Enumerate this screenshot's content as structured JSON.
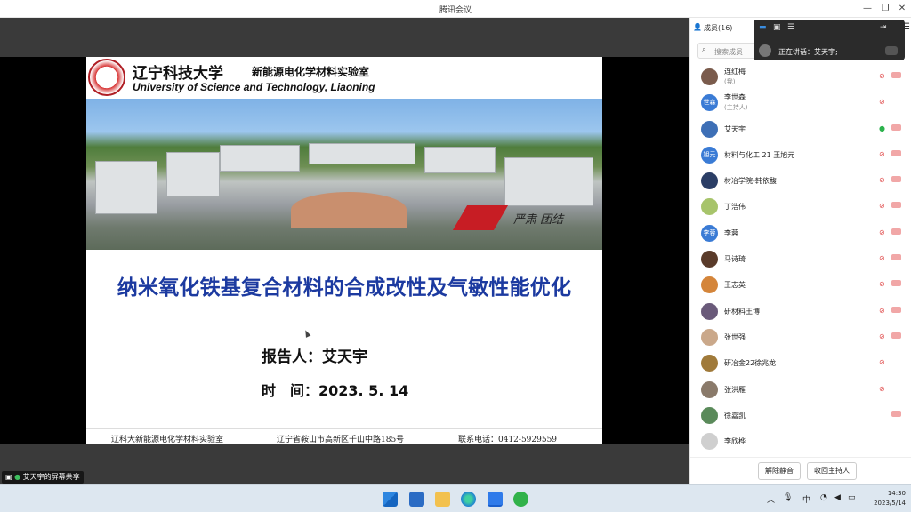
{
  "window": {
    "title": "腾讯会议"
  },
  "share_label": "艾天宇的屏幕共享",
  "slide": {
    "university_cn": "辽宁科技大学",
    "lab_cn": "新能源电化学材料实验室",
    "university_en": "University of Science and Technology, Liaoning",
    "signature": "严肃 团结",
    "title": "纳米氧化铁基复合材料的合成改性及气敏性能优化",
    "presenter": "报告人：艾天宇",
    "date": "时　间：2023. 5. 14",
    "footer": {
      "lab": "辽科大新能源电化学材料实验室",
      "address": "辽宁省鞍山市高新区千山中路185号",
      "phone": "联系电话：0412-5929559"
    }
  },
  "panel": {
    "members_title": "成员(16)",
    "search_placeholder": "搜索成员",
    "speaking": "正在讲话：艾天宇;",
    "members": [
      {
        "name": "连红梅",
        "sub": "(我)",
        "avatar_text": "",
        "mic": "muted",
        "cam": true,
        "color": "#7a5b4c"
      },
      {
        "name": "李世森",
        "sub": "(主持人)",
        "avatar_text": "世森",
        "mic": "muted",
        "cam": false,
        "color": "#3a7bd5"
      },
      {
        "name": "艾天宇",
        "sub": "",
        "avatar_text": "",
        "mic": "on",
        "cam": true,
        "color": "#3d6fb6"
      },
      {
        "name": "材料与化工 21 王旭元",
        "sub": "",
        "avatar_text": "旭元",
        "mic": "muted",
        "cam": true,
        "color": "#3a7bd5"
      },
      {
        "name": "材冶学院-韩依馥",
        "sub": "",
        "avatar_text": "",
        "mic": "muted",
        "cam": true,
        "color": "#2b3e66"
      },
      {
        "name": "丁浩伟",
        "sub": "",
        "avatar_text": "",
        "mic": "muted",
        "cam": true,
        "color": "#a7c46b"
      },
      {
        "name": "李蓉",
        "sub": "",
        "avatar_text": "李蓉",
        "mic": "muted",
        "cam": true,
        "color": "#3a7bd5"
      },
      {
        "name": "马诗琦",
        "sub": "",
        "avatar_text": "",
        "mic": "muted",
        "cam": true,
        "color": "#5a3b2a"
      },
      {
        "name": "王志英",
        "sub": "",
        "avatar_text": "",
        "mic": "muted",
        "cam": true,
        "color": "#d4853a"
      },
      {
        "name": "研材料王博",
        "sub": "",
        "avatar_text": "",
        "mic": "muted",
        "cam": true,
        "color": "#6a5a7a"
      },
      {
        "name": "张世强",
        "sub": "",
        "avatar_text": "",
        "mic": "muted",
        "cam": true,
        "color": "#caa88a"
      },
      {
        "name": "研冶金22徐兆龙",
        "sub": "",
        "avatar_text": "",
        "mic": "muted",
        "cam": false,
        "color": "#a07a3a"
      },
      {
        "name": "张洪雁",
        "sub": "",
        "avatar_text": "",
        "mic": "muted",
        "cam": false,
        "color": "#8a7a6a"
      },
      {
        "name": "徐嘉凯",
        "sub": "",
        "avatar_text": "",
        "mic": "none",
        "cam": true,
        "color": "#5a8a5a"
      },
      {
        "name": "李欣桦",
        "sub": "",
        "avatar_text": "",
        "mic": "none",
        "cam": false,
        "color": "#cfcfcf"
      }
    ],
    "btn_unmute": "解除静音",
    "btn_reclaim": "收回主持人"
  },
  "taskbar": {
    "ime": "中",
    "time": "14:30",
    "date": "2023/5/14"
  }
}
